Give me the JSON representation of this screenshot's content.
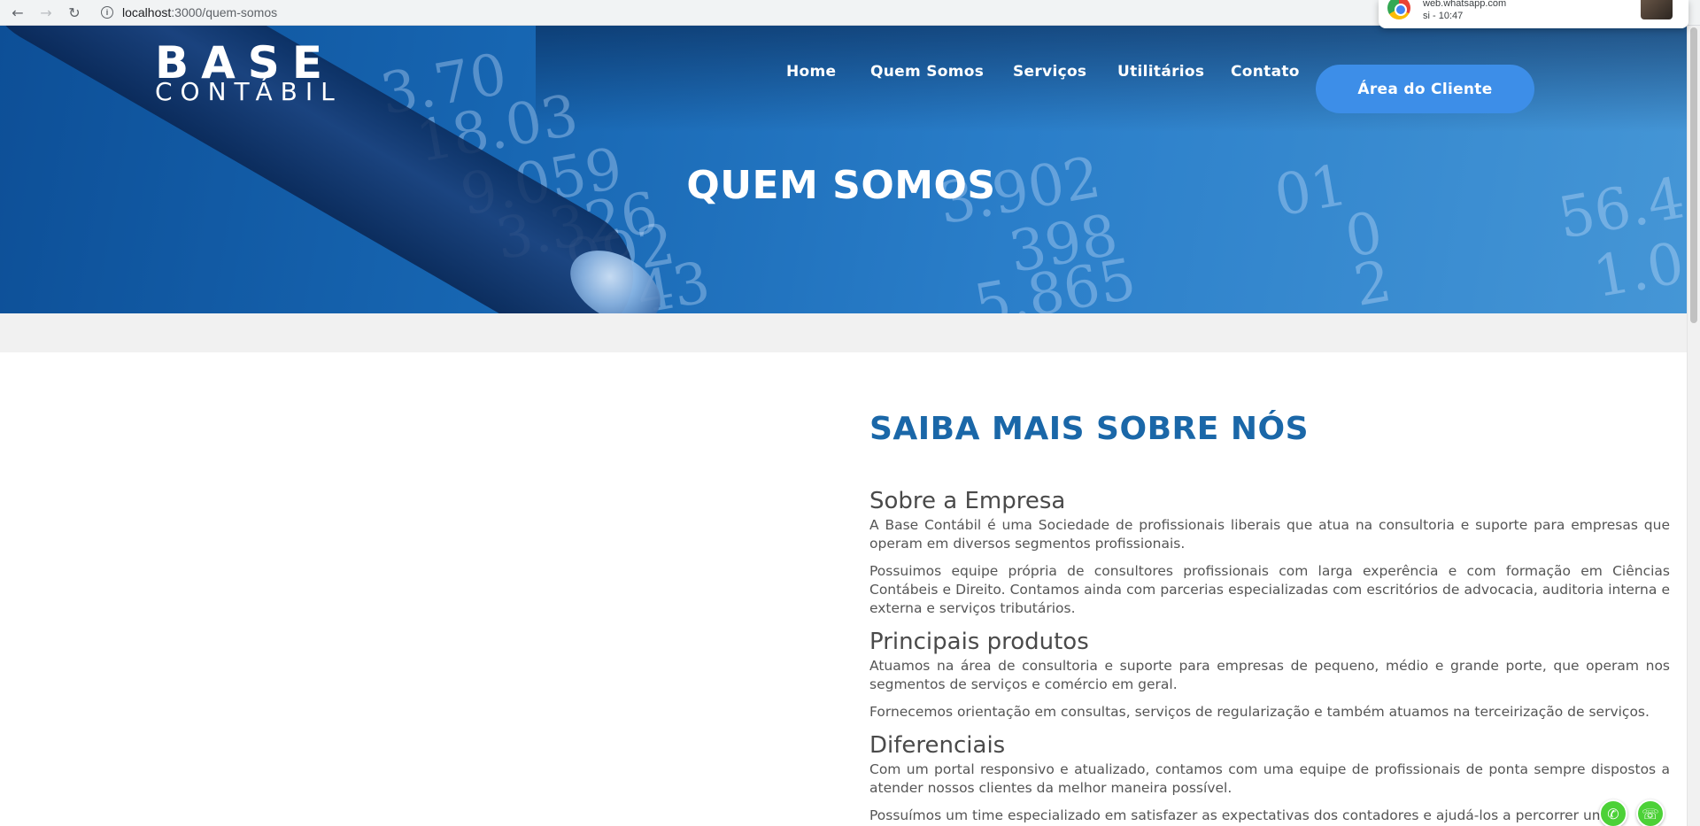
{
  "browser": {
    "host": "localhost",
    "path": ":3000/quem-somos",
    "back_icon": "arrow-left-icon",
    "forward_icon": "arrow-right-icon",
    "reload_icon": "reload-icon"
  },
  "notification": {
    "source": "web.whatsapp.com",
    "time": "si - 10:47"
  },
  "header": {
    "logo_line1": "BASE",
    "logo_line2": "CONTÁBIL",
    "nav": [
      "Home",
      "Quem Somos",
      "Serviços",
      "Utilitários",
      "Contato"
    ],
    "client_button": "Área do Cliente",
    "hero_title": "QUEM SOMOS"
  },
  "hero_numbers": [
    "3.70",
    "18.03",
    "9.059",
    "3.326",
    "992",
    "43",
    "3.902",
    "398",
    "5.865",
    "01",
    "0",
    "2",
    "56.4",
    "1.0"
  ],
  "main": {
    "title": "SAIBA MAIS SOBRE NÓS",
    "sections": [
      {
        "heading": "Sobre a Empresa",
        "paragraphs": [
          "A Base Contábil é uma Sociedade de profissionais liberais que atua na consultoria e suporte para empresas que operam em diversos segmentos profissionais.",
          "Possuimos equipe própria de consultores profissionais com larga experência e com formação em Ciências Contábeis e Direito. Contamos ainda com parcerias especializadas com escritórios de advocacia, auditoria interna e externa e serviços tributários."
        ]
      },
      {
        "heading": "Principais produtos",
        "paragraphs": [
          "Atuamos na área de consultoria e suporte para empresas de pequeno, médio e grande porte, que operam nos segmentos de serviços e comércio em geral.",
          "Fornecemos orientação em consultas, serviços de regularização e também atuamos na terceirização de serviços."
        ]
      },
      {
        "heading": "Diferenciais",
        "paragraphs": [
          "Com um portal responsivo e atualizado, contamos com uma equipe de profissionais de ponta sempre dispostos a atender nossos clientes da melhor maneira possível.",
          "Possuímos um time especializado em satisfazer as expectativas dos contadores e ajudá-los a percorrer um"
        ]
      }
    ]
  },
  "colors": {
    "title_blue": "#1a67a8",
    "button_blue": "#3d8ee8",
    "whatsapp_green": "#4cd137"
  }
}
